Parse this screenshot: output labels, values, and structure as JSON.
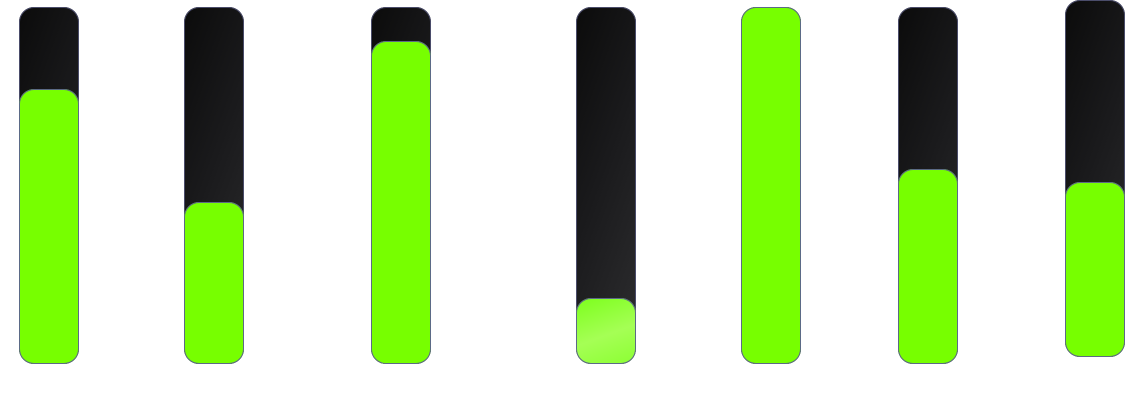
{
  "meters": [
    {
      "name": "meter-1",
      "level": 0.77,
      "color": "#77ff00"
    },
    {
      "name": "meter-2",
      "level": 0.455,
      "color": "#77ff00"
    },
    {
      "name": "meter-3",
      "level": 0.905,
      "color": "#77ff00"
    },
    {
      "name": "meter-4",
      "level": 0.185,
      "color": "#8cff33"
    },
    {
      "name": "meter-5",
      "level": 1.0,
      "color": "#77ff00"
    },
    {
      "name": "meter-6",
      "level": 0.545,
      "color": "#77ff00"
    },
    {
      "name": "meter-7",
      "level": 0.49,
      "color": "#77ff00"
    }
  ]
}
